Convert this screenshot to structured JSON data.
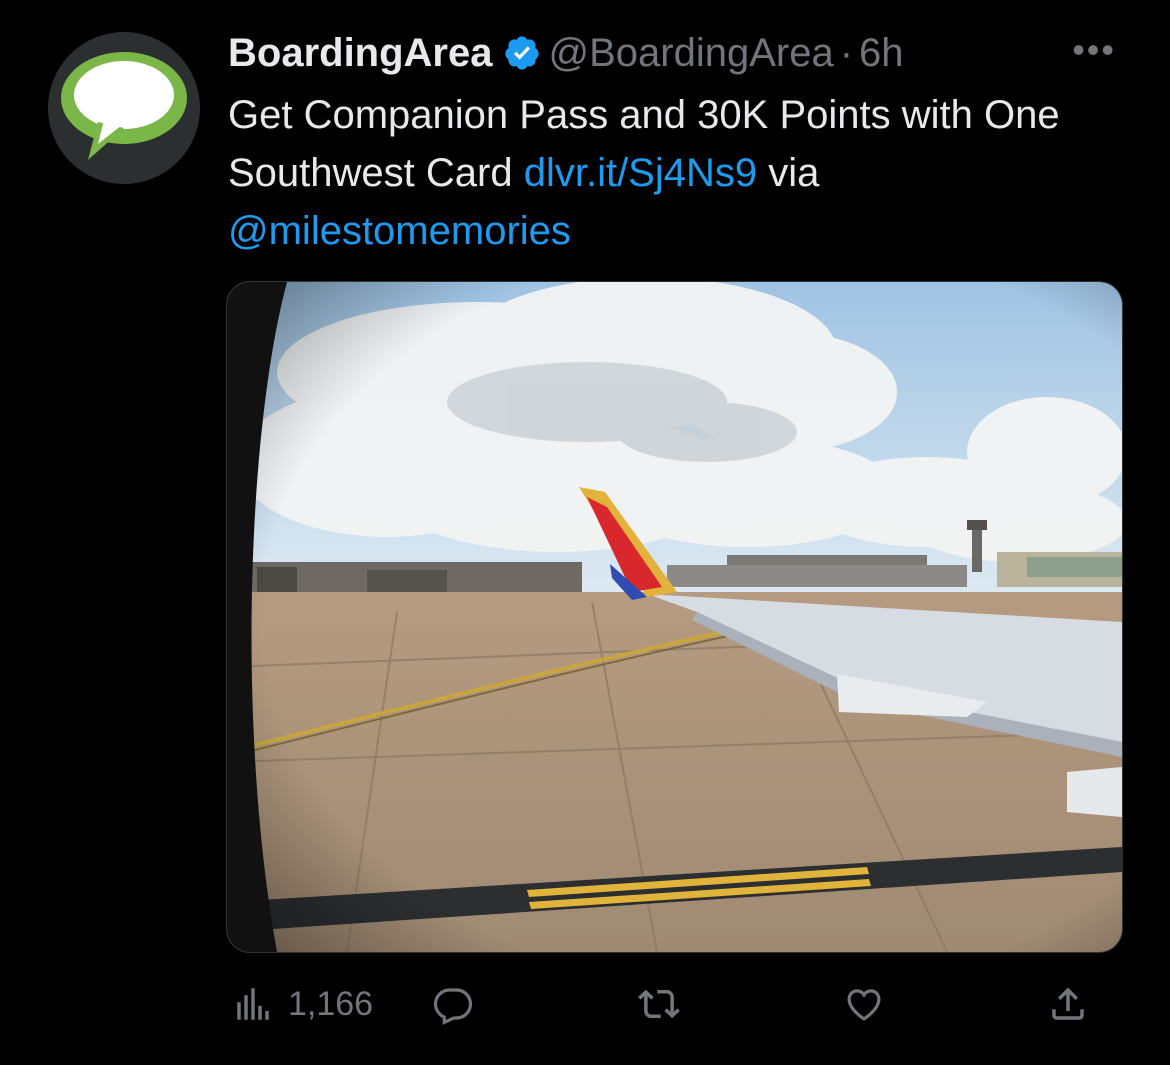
{
  "tweet": {
    "display_name": "BoardingArea",
    "verified": true,
    "handle": "@BoardingArea",
    "separator": "·",
    "time": "6h",
    "more_label": "•••",
    "text_part1": "Get Companion Pass and 30K Points with One Southwest Card ",
    "link": "dlvr.it/Sj4Ns9",
    "text_part2": " via ",
    "mention": "@milestomemories"
  },
  "actions": {
    "views_count": "1,166"
  },
  "icons": {
    "avatar": "speech-bubble-logo",
    "verified": "verified-badge-icon",
    "more": "more-icon",
    "views": "views-icon",
    "reply": "reply-icon",
    "retweet": "retweet-icon",
    "like": "heart-icon",
    "share": "share-icon"
  },
  "colors": {
    "background": "#000000",
    "text": "#e7e9ea",
    "secondary": "#71767b",
    "link": "#1d9bf0",
    "avatar_green": "#7ab648"
  }
}
